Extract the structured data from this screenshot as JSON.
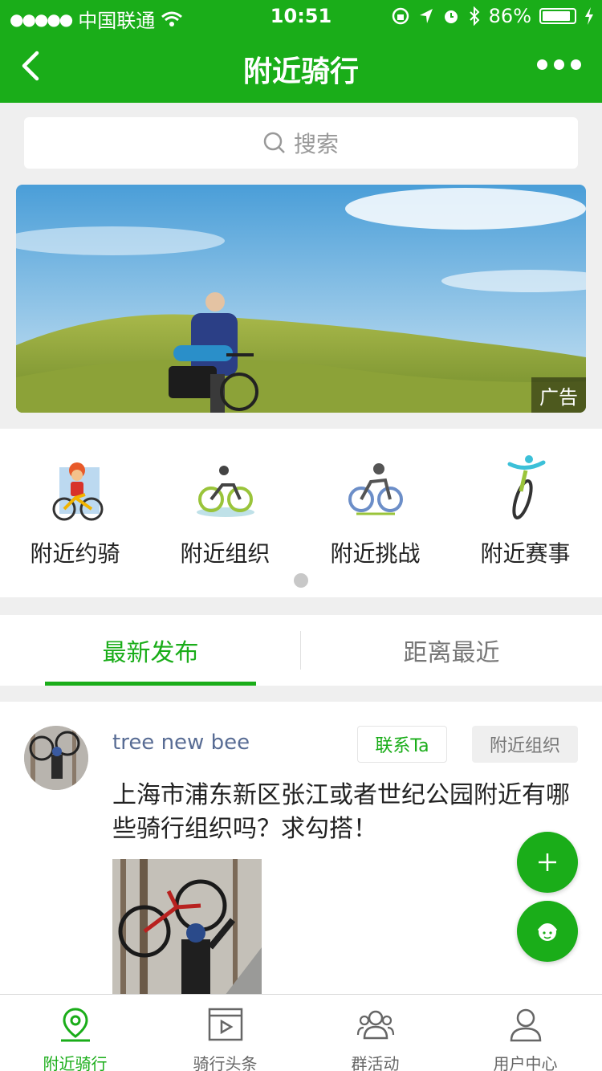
{
  "status": {
    "carrier": "中国联通",
    "time": "10:51",
    "battery": "86%"
  },
  "nav": {
    "title": "附近骑行"
  },
  "search": {
    "placeholder": "搜索"
  },
  "banner": {
    "badge": "广告"
  },
  "categories": [
    {
      "label": "附近约骑",
      "icon": "cyclist-cartoon-icon"
    },
    {
      "label": "附近组织",
      "icon": "cycling-group-icon"
    },
    {
      "label": "附近挑战",
      "icon": "cycling-challenge-icon"
    },
    {
      "label": "附近赛事",
      "icon": "cycling-race-icon"
    }
  ],
  "tabs": [
    {
      "label": "最新发布",
      "active": true
    },
    {
      "label": "距离最近",
      "active": false
    }
  ],
  "post": {
    "username": "tree new bee",
    "contact_label": "联系Ta",
    "tag": "附近组织",
    "text": "上海市浦东新区张江或者世纪公园附近有哪些骑行组织吗？求勾搭！"
  },
  "tabbar": [
    {
      "label": "附近骑行",
      "icon": "location-pin-icon",
      "active": true
    },
    {
      "label": "骑行头条",
      "icon": "video-play-icon",
      "active": false
    },
    {
      "label": "群活动",
      "icon": "group-icon",
      "active": false
    },
    {
      "label": "用户中心",
      "icon": "user-icon",
      "active": false
    }
  ],
  "colors": {
    "brand": "#1aad19",
    "link": "#586c94"
  }
}
